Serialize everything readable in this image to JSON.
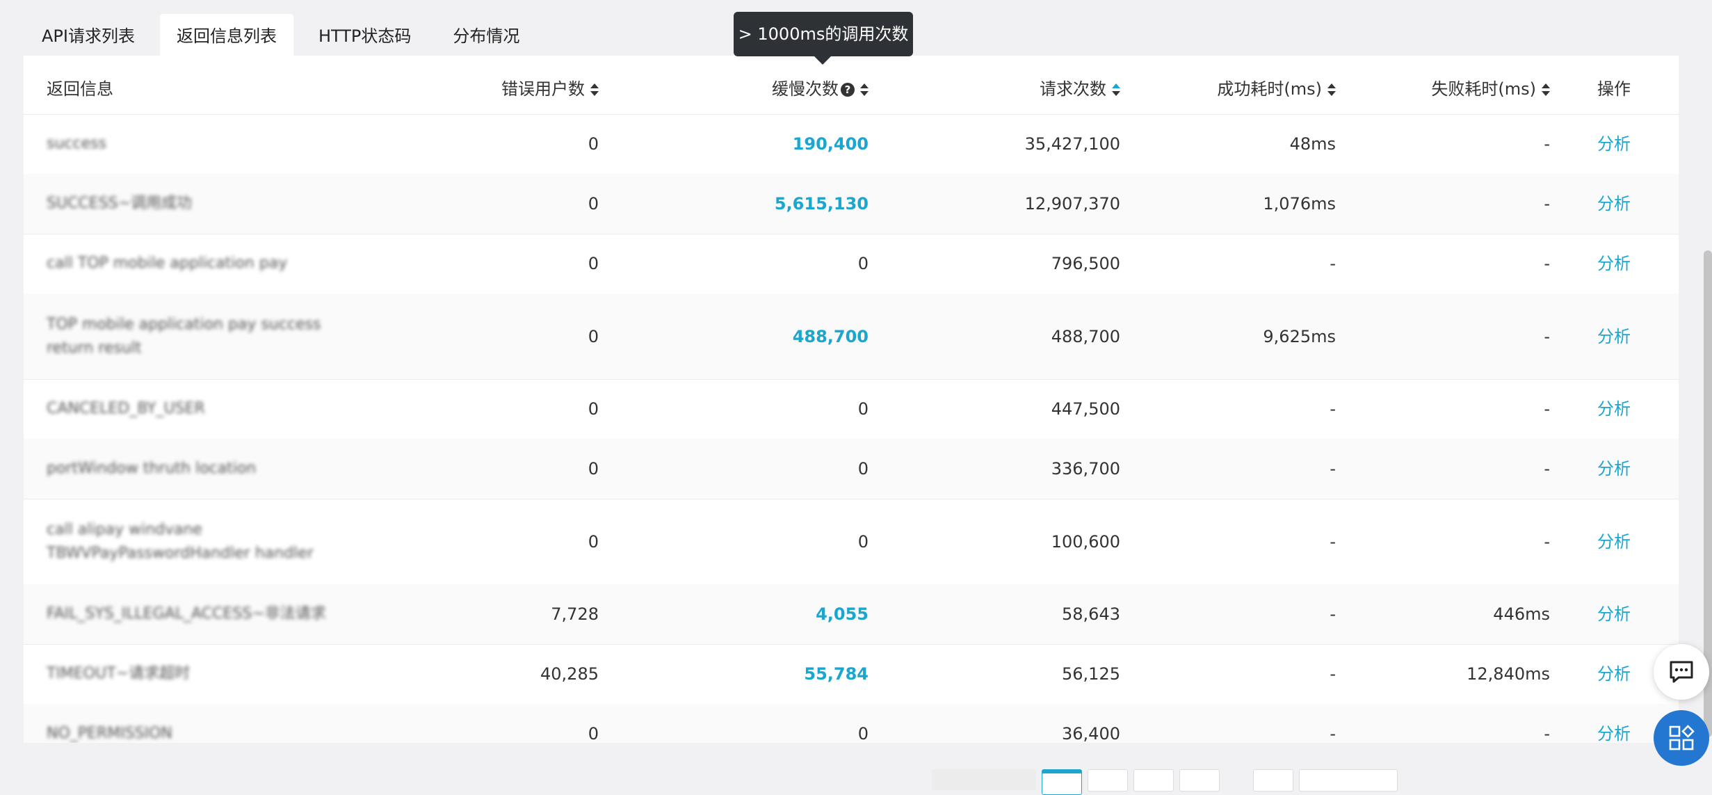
{
  "tabs": [
    {
      "label": "API请求列表"
    },
    {
      "label": "返回信息列表"
    },
    {
      "label": "HTTP状态码"
    },
    {
      "label": "分布情况"
    }
  ],
  "active_tab": 1,
  "tooltip": "> 1000ms的调用次数",
  "table": {
    "headers": {
      "return_info": "返回信息",
      "error_users": "错误用户数",
      "slow_count": "缓慢次数",
      "request_count": "请求次数",
      "success_time": "成功耗时(ms)",
      "fail_time": "失败耗时(ms)",
      "action": "操作"
    },
    "help_icon_glyph": "?",
    "rows": [
      {
        "info": "success",
        "error_users": "0",
        "slow": "190,400",
        "requests": "35,427,100",
        "success_time": "48ms",
        "fail_time": "-",
        "action": "分析"
      },
      {
        "info": "SUCCESS~调用成功",
        "error_users": "0",
        "slow": "5,615,130",
        "requests": "12,907,370",
        "success_time": "1,076ms",
        "fail_time": "-",
        "action": "分析"
      },
      {
        "info": "call TOP mobile application pay",
        "error_users": "0",
        "slow": "0",
        "requests": "796,500",
        "success_time": "-",
        "fail_time": "-",
        "action": "分析"
      },
      {
        "info": "TOP mobile application pay success return result",
        "error_users": "0",
        "slow": "488,700",
        "requests": "488,700",
        "success_time": "9,625ms",
        "fail_time": "-",
        "action": "分析"
      },
      {
        "info": "CANCELED_BY_USER",
        "error_users": "0",
        "slow": "0",
        "requests": "447,500",
        "success_time": "-",
        "fail_time": "-",
        "action": "分析"
      },
      {
        "info": "portWindow thruth location",
        "error_users": "0",
        "slow": "0",
        "requests": "336,700",
        "success_time": "-",
        "fail_time": "-",
        "action": "分析"
      },
      {
        "info": "call alipay windvane TBWVPayPasswordHandler handler",
        "error_users": "0",
        "slow": "0",
        "requests": "100,600",
        "success_time": "-",
        "fail_time": "-",
        "action": "分析"
      },
      {
        "info": "FAIL_SYS_ILLEGAL_ACCESS~非法请求",
        "error_users": "7,728",
        "slow": "4,055",
        "requests": "58,643",
        "success_time": "-",
        "fail_time": "446ms",
        "action": "分析"
      },
      {
        "info": "TIMEOUT~请求超时",
        "error_users": "40,285",
        "slow": "55,784",
        "requests": "56,125",
        "success_time": "-",
        "fail_time": "12,840ms",
        "action": "分析"
      },
      {
        "info": "NO_PERMISSION",
        "error_users": "0",
        "slow": "0",
        "requests": "36,400",
        "success_time": "-",
        "fail_time": "-",
        "action": "分析"
      }
    ]
  },
  "colors": {
    "accent": "#1aa6cf",
    "fab_blue": "#2377d1",
    "tooltip_bg": "#2e3236"
  },
  "icons": {
    "chat": "chat-icon",
    "apps": "apps-icon"
  }
}
